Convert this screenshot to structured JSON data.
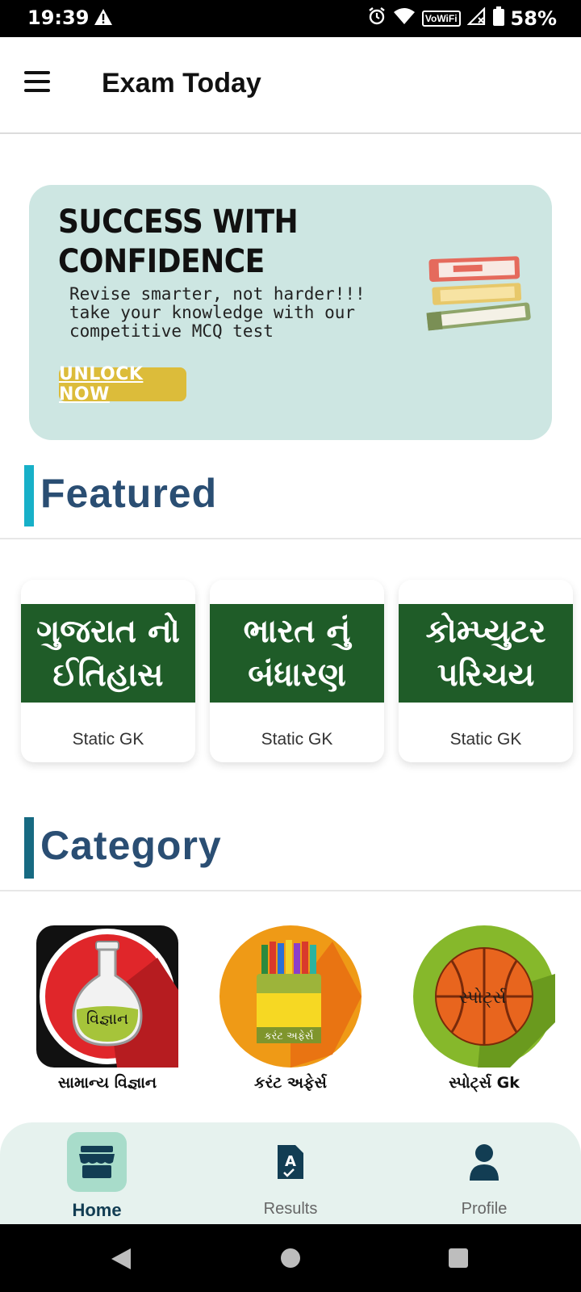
{
  "status_bar": {
    "time": "19:39",
    "vowifi": "VoWiFi",
    "battery": "58%"
  },
  "app_bar": {
    "title": "Exam Today"
  },
  "banner": {
    "title_line1": "SUCCESS WITH",
    "title_line2": "CONFIDENCE",
    "text": "Revise smarter, not harder!!!\ntake your knowledge with our\ncompetitive MCQ test",
    "button": "UNLOCK NOW",
    "book_labels": [
      "",
      ""
    ],
    "bg_color": "#cde6e2"
  },
  "featured": {
    "title": "Featured",
    "accent": "#17b0c8",
    "cards": [
      {
        "title": "ગુજરાત નો ઈતિહાસ",
        "label": "Static GK"
      },
      {
        "title": "ભારત નું બંધારણ",
        "label": "Static GK"
      },
      {
        "title": "કોમ્પ્યુટર પરિચય",
        "label": "Static GK"
      }
    ]
  },
  "category": {
    "title": "Category",
    "accent": "#176a82",
    "items": [
      {
        "icon_text": "વિજ્ઞાન",
        "label": "સામાન્ય વિજ્ઞાન",
        "icon": "flask-icon"
      },
      {
        "icon_text": "કરંટ અફેર્સ",
        "label": "કરંટ અફેર્સ",
        "icon": "crayons-icon"
      },
      {
        "icon_text": "સ્પોર્ટ્સ",
        "label": "સ્પોર્ટ્સ Gk",
        "icon": "basketball-icon"
      }
    ]
  },
  "bottom_nav": {
    "items": [
      {
        "label": "Home",
        "icon": "store-icon",
        "active": true
      },
      {
        "label": "Results",
        "icon": "result-file-icon",
        "active": false
      },
      {
        "label": "Profile",
        "icon": "person-icon",
        "active": false
      }
    ]
  }
}
